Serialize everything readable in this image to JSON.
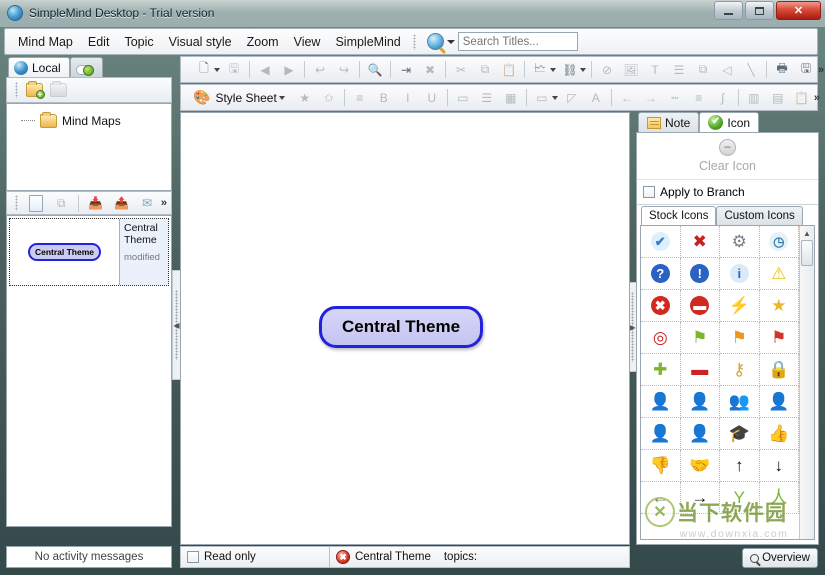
{
  "window": {
    "title": "SimpleMind Desktop - Trial version",
    "icon": "app-globe-icon",
    "minimize": "–",
    "maximize": "□",
    "close": "✕"
  },
  "menubar": {
    "items": [
      "Mind Map",
      "Edit",
      "Topic",
      "Visual style",
      "Zoom",
      "View",
      "SimpleMind"
    ],
    "search": {
      "placeholder": "Search Titles...",
      "value": "",
      "icon": "search-icon"
    }
  },
  "toolbar_row1": {
    "buttons": [
      {
        "name": "new-document-button",
        "glyph": "🗋",
        "dim": false,
        "dropdown": true
      },
      {
        "name": "save-button",
        "glyph": "🖫",
        "dim": true
      },
      {
        "sep": true
      },
      {
        "name": "back-button",
        "glyph": "◀",
        "dim": true
      },
      {
        "name": "forward-button",
        "glyph": "▶",
        "dim": true
      },
      {
        "sep": true
      },
      {
        "name": "undo-button",
        "glyph": "↩",
        "dim": true
      },
      {
        "name": "redo-button",
        "glyph": "↪",
        "dim": true
      },
      {
        "sep": true
      },
      {
        "name": "zoom-button",
        "glyph": "🔍",
        "dim": false
      },
      {
        "sep": true
      },
      {
        "name": "add-topic-button",
        "glyph": "⇥",
        "dim": false
      },
      {
        "name": "delete-topic-button",
        "glyph": "✖",
        "dim": true
      },
      {
        "sep": true
      },
      {
        "name": "cut-button",
        "glyph": "✂",
        "dim": true
      },
      {
        "name": "copy-button",
        "glyph": "⧉",
        "dim": true
      },
      {
        "name": "paste-button",
        "glyph": "📋",
        "dim": true
      },
      {
        "sep": true
      },
      {
        "name": "layout-button",
        "glyph": "🗠",
        "dim": false,
        "dropdown": true
      },
      {
        "name": "auto-layout-button",
        "glyph": "⛓",
        "dim": false,
        "dropdown": true
      },
      {
        "sep": true
      },
      {
        "name": "checkbox-button",
        "glyph": "⊘",
        "dim": true
      },
      {
        "name": "image-button",
        "glyph": "🖼",
        "dim": true
      },
      {
        "name": "text-note-button",
        "glyph": "T",
        "dim": true
      },
      {
        "name": "list-button",
        "glyph": "☰",
        "dim": true
      },
      {
        "name": "clone-button",
        "glyph": "⧉",
        "dim": true
      },
      {
        "name": "shape-button",
        "glyph": "◁",
        "dim": true
      },
      {
        "name": "line-button",
        "glyph": "╲",
        "dim": true
      },
      {
        "sep": true
      },
      {
        "name": "print-button",
        "glyph": "🖶",
        "dim": false
      },
      {
        "name": "export-button",
        "glyph": "🖫",
        "dim": false
      }
    ],
    "overflow": "»"
  },
  "toolbar_row2": {
    "style_sheet_label": "Style Sheet",
    "style_sheet_icon": "palette-icon",
    "buttons": [
      {
        "name": "favorite-style-button",
        "glyph": "★",
        "dim": true
      },
      {
        "name": "add-style-button",
        "glyph": "✩",
        "dim": true
      },
      {
        "sep": true
      },
      {
        "name": "align-text-button",
        "glyph": "≡",
        "dim": true
      },
      {
        "name": "bold-button",
        "glyph": "B",
        "dim": true
      },
      {
        "name": "italic-button",
        "glyph": "I",
        "dim": true
      },
      {
        "name": "underline-button",
        "glyph": "U",
        "dim": true
      },
      {
        "sep": true
      },
      {
        "name": "border-button",
        "glyph": "▭",
        "dim": true
      },
      {
        "name": "fill-lines-button",
        "glyph": "☰",
        "dim": true
      },
      {
        "name": "grid-button",
        "glyph": "▦",
        "dim": true
      },
      {
        "sep": true
      },
      {
        "name": "fill-color-button",
        "glyph": "▭",
        "dim": true,
        "dropdown": true
      },
      {
        "name": "pen-color-button",
        "glyph": "◸",
        "dim": true
      },
      {
        "name": "font-color-button",
        "glyph": "A",
        "dim": true
      },
      {
        "sep": true
      },
      {
        "name": "arrow-left-button",
        "glyph": "←",
        "dim": true
      },
      {
        "name": "arrow-right-button",
        "glyph": "→",
        "dim": true
      },
      {
        "name": "dashed-line-button",
        "glyph": "┉",
        "dim": true
      },
      {
        "name": "line-weight-button",
        "glyph": "≡",
        "dim": true
      },
      {
        "name": "curve-button",
        "glyph": "∫",
        "dim": true
      },
      {
        "sep": true
      },
      {
        "name": "columns-button",
        "glyph": "▥",
        "dim": true
      },
      {
        "name": "table-button",
        "glyph": "▤",
        "dim": true
      },
      {
        "name": "clipboard-style-button",
        "glyph": "📋",
        "dim": true
      }
    ],
    "overflow": "»"
  },
  "left_panel": {
    "tabs": [
      {
        "label": "Local",
        "icon": "globe-icon",
        "active": true
      },
      {
        "label": "",
        "icon": "cloud-upload-icon",
        "active": false
      }
    ],
    "folder_toolbar": [
      {
        "name": "new-folder-button",
        "icon": "folder-add-icon",
        "dim": false
      },
      {
        "name": "delete-folder-button",
        "icon": "folder-delete-icon",
        "dim": true
      }
    ],
    "tree": [
      {
        "label": "Mind Maps",
        "icon": "folder-icon"
      }
    ],
    "list_toolbar": [
      {
        "name": "new-map-button",
        "icon": "new-document-icon"
      },
      {
        "name": "duplicate-map-button",
        "icon": "copy-icon"
      },
      {
        "name": "import-map-button",
        "icon": "import-icon"
      },
      {
        "name": "export-map-button",
        "icon": "export-icon"
      },
      {
        "name": "email-map-button",
        "icon": "email-icon"
      },
      {
        "name": "more-button",
        "icon": "chevron-double-right-icon",
        "label": "»"
      }
    ],
    "items": [
      {
        "preview_label": "Central Theme",
        "title": "Central Theme",
        "status": "modified",
        "selected": true
      }
    ],
    "activity_status": "No activity messages"
  },
  "canvas": {
    "node": {
      "label": "Central Theme"
    },
    "fill_color": "#ccccf2",
    "border_color": "#2222dd"
  },
  "right_panel": {
    "tabs": [
      {
        "label": "Note",
        "icon": "note-icon",
        "active": false
      },
      {
        "label": "Icon",
        "icon": "check-circle-icon",
        "active": true
      }
    ],
    "clear_icon": {
      "label": "Clear Icon",
      "icon": "minus-circle-icon",
      "disabled": true
    },
    "apply_to_branch": {
      "label": "Apply to Branch",
      "checked": false
    },
    "icon_tabs": [
      {
        "label": "Stock Icons",
        "active": true
      },
      {
        "label": "Custom Icons",
        "active": false
      }
    ],
    "stock_icons": [
      {
        "name": "check-circle-blue-icon",
        "glyph": "✔",
        "color": "#2f7fd0",
        "bg": "#dff0fb"
      },
      {
        "name": "red-x-icon",
        "glyph": "✖",
        "color": "#cc2020",
        "bg": "transparent"
      },
      {
        "name": "gear-icon",
        "glyph": "⚙",
        "color": "#7a8088",
        "bg": "transparent"
      },
      {
        "name": "clock-icon",
        "glyph": "◷",
        "color": "#3f7fae",
        "bg": "#e6f2fa"
      },
      {
        "name": "question-circle-icon",
        "glyph": "?",
        "color": "#ffffff",
        "bg": "#2a62c4"
      },
      {
        "name": "exclamation-circle-icon",
        "glyph": "!",
        "color": "#ffffff",
        "bg": "#2a62c4"
      },
      {
        "name": "info-diamond-icon",
        "glyph": "i",
        "color": "#2a62c4",
        "bg": "#dbeaf9"
      },
      {
        "name": "warning-triangle-icon",
        "glyph": "⚠",
        "color": "#e8c21a",
        "bg": "transparent"
      },
      {
        "name": "x-circle-red-icon",
        "glyph": "✖",
        "color": "#ffffff",
        "bg": "#d02a20"
      },
      {
        "name": "no-entry-icon",
        "glyph": "▬",
        "color": "#ffffff",
        "bg": "#d02a20"
      },
      {
        "name": "lightning-icon",
        "glyph": "⚡",
        "color": "#edc01f",
        "bg": "transparent"
      },
      {
        "name": "star-icon",
        "glyph": "★",
        "color": "#e8b825",
        "bg": "transparent"
      },
      {
        "name": "target-icon",
        "glyph": "◎",
        "color": "#cc2424",
        "bg": "transparent"
      },
      {
        "name": "flag-green-icon",
        "glyph": "⚑",
        "color": "#7cb531",
        "bg": "transparent"
      },
      {
        "name": "flag-orange-icon",
        "glyph": "⚑",
        "color": "#eb9a21",
        "bg": "transparent"
      },
      {
        "name": "flag-red-icon",
        "glyph": "⚑",
        "color": "#d0342a",
        "bg": "transparent"
      },
      {
        "name": "plus-green-icon",
        "glyph": "✚",
        "color": "#7cb531",
        "bg": "transparent"
      },
      {
        "name": "minus-red-icon",
        "glyph": "▬",
        "color": "#cc2424",
        "bg": "transparent"
      },
      {
        "name": "key-icon",
        "glyph": "⚷",
        "color": "#d6a82a",
        "bg": "transparent"
      },
      {
        "name": "lock-icon",
        "glyph": "🔒",
        "color": "#d6a82a",
        "bg": "transparent"
      },
      {
        "name": "person-blue-icon",
        "glyph": "👤",
        "color": "#4a8fc4",
        "bg": "transparent"
      },
      {
        "name": "person-pink-icon",
        "glyph": "👤",
        "color": "#c47fc4",
        "bg": "transparent"
      },
      {
        "name": "group-icon",
        "glyph": "👥",
        "color": "#4a8fc4",
        "bg": "transparent"
      },
      {
        "name": "presenter-icon",
        "glyph": "👤",
        "color": "#9a6a3a",
        "bg": "transparent"
      },
      {
        "name": "officer-icon",
        "glyph": "👤",
        "color": "#5a7a4a",
        "bg": "transparent"
      },
      {
        "name": "worker-icon",
        "glyph": "👤",
        "color": "#e08a2a",
        "bg": "transparent"
      },
      {
        "name": "graduate-icon",
        "glyph": "🎓",
        "color": "#3a5a8a",
        "bg": "transparent"
      },
      {
        "name": "thumbs-up-icon",
        "glyph": "👍",
        "color": "#e0b25a",
        "bg": "transparent"
      },
      {
        "name": "thumbs-down-icon",
        "glyph": "👎",
        "color": "#e0b25a",
        "bg": "transparent"
      },
      {
        "name": "handshake-icon",
        "glyph": "🤝",
        "color": "#d6a050",
        "bg": "transparent"
      },
      {
        "name": "arrow-up-circle-icon",
        "glyph": "↑",
        "color": "#111111",
        "bg": "transparent"
      },
      {
        "name": "arrow-down-circle-icon",
        "glyph": "↓",
        "color": "#111111",
        "bg": "transparent"
      },
      {
        "name": "arrow-left-circle-icon",
        "glyph": "←",
        "color": "#111111",
        "bg": "transparent"
      },
      {
        "name": "arrow-right-circle-icon",
        "glyph": "→",
        "color": "#111111",
        "bg": "transparent"
      },
      {
        "name": "person-arms-up-icon",
        "glyph": "Y",
        "color": "#7cb531",
        "bg": "transparent"
      },
      {
        "name": "person-standing-icon",
        "glyph": "人",
        "color": "#7cb531",
        "bg": "transparent"
      }
    ]
  },
  "statusbar": {
    "read_only": {
      "label": "Read only",
      "checked": false
    },
    "map_icon": "red-target-icon",
    "map_name": "Central Theme",
    "topics_label": "topics:",
    "topics_count": "",
    "overview_button": {
      "label": "Overview",
      "icon": "magnifier-icon"
    }
  },
  "watermark": {
    "logo_glyph": "✕",
    "text": "当下软件园",
    "url": "www.downxia.com"
  }
}
